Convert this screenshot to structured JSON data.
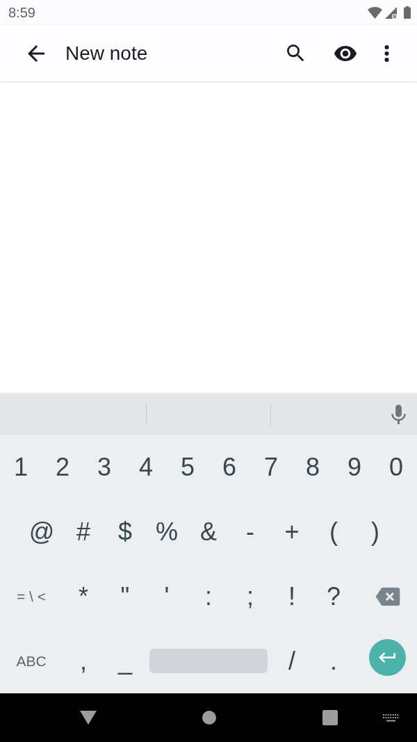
{
  "status_bar": {
    "time": "8:59"
  },
  "app_bar": {
    "title": "New note"
  },
  "keyboard": {
    "rows": [
      {
        "keys": [
          {
            "kind": "char",
            "label": "1"
          },
          {
            "kind": "char",
            "label": "2"
          },
          {
            "kind": "char",
            "label": "3"
          },
          {
            "kind": "char",
            "label": "4"
          },
          {
            "kind": "char",
            "label": "5"
          },
          {
            "kind": "char",
            "label": "6"
          },
          {
            "kind": "char",
            "label": "7"
          },
          {
            "kind": "char",
            "label": "8"
          },
          {
            "kind": "char",
            "label": "9"
          },
          {
            "kind": "char",
            "label": "0"
          }
        ]
      },
      {
        "keys": [
          {
            "kind": "char",
            "label": "@"
          },
          {
            "kind": "char",
            "label": "#"
          },
          {
            "kind": "char",
            "label": "$"
          },
          {
            "kind": "char",
            "label": "%"
          },
          {
            "kind": "char",
            "label": "&"
          },
          {
            "kind": "char",
            "label": "-"
          },
          {
            "kind": "char",
            "label": "+"
          },
          {
            "kind": "char",
            "label": "("
          },
          {
            "kind": "char",
            "label": ")"
          }
        ]
      },
      {
        "keys": [
          {
            "kind": "mode",
            "label": "= \\ <"
          },
          {
            "kind": "char",
            "label": "*"
          },
          {
            "kind": "char",
            "label": "\""
          },
          {
            "kind": "char",
            "label": "'"
          },
          {
            "kind": "char",
            "label": ":"
          },
          {
            "kind": "char",
            "label": ";"
          },
          {
            "kind": "char",
            "label": "!"
          },
          {
            "kind": "char",
            "label": "?"
          },
          {
            "kind": "backspace"
          }
        ]
      },
      {
        "keys": [
          {
            "kind": "mode",
            "label": "ABC"
          },
          {
            "kind": "char",
            "label": ","
          },
          {
            "kind": "char",
            "label": "_"
          },
          {
            "kind": "space"
          },
          {
            "kind": "char",
            "label": "/"
          },
          {
            "kind": "char",
            "label": "."
          },
          {
            "kind": "enter"
          }
        ]
      }
    ]
  }
}
